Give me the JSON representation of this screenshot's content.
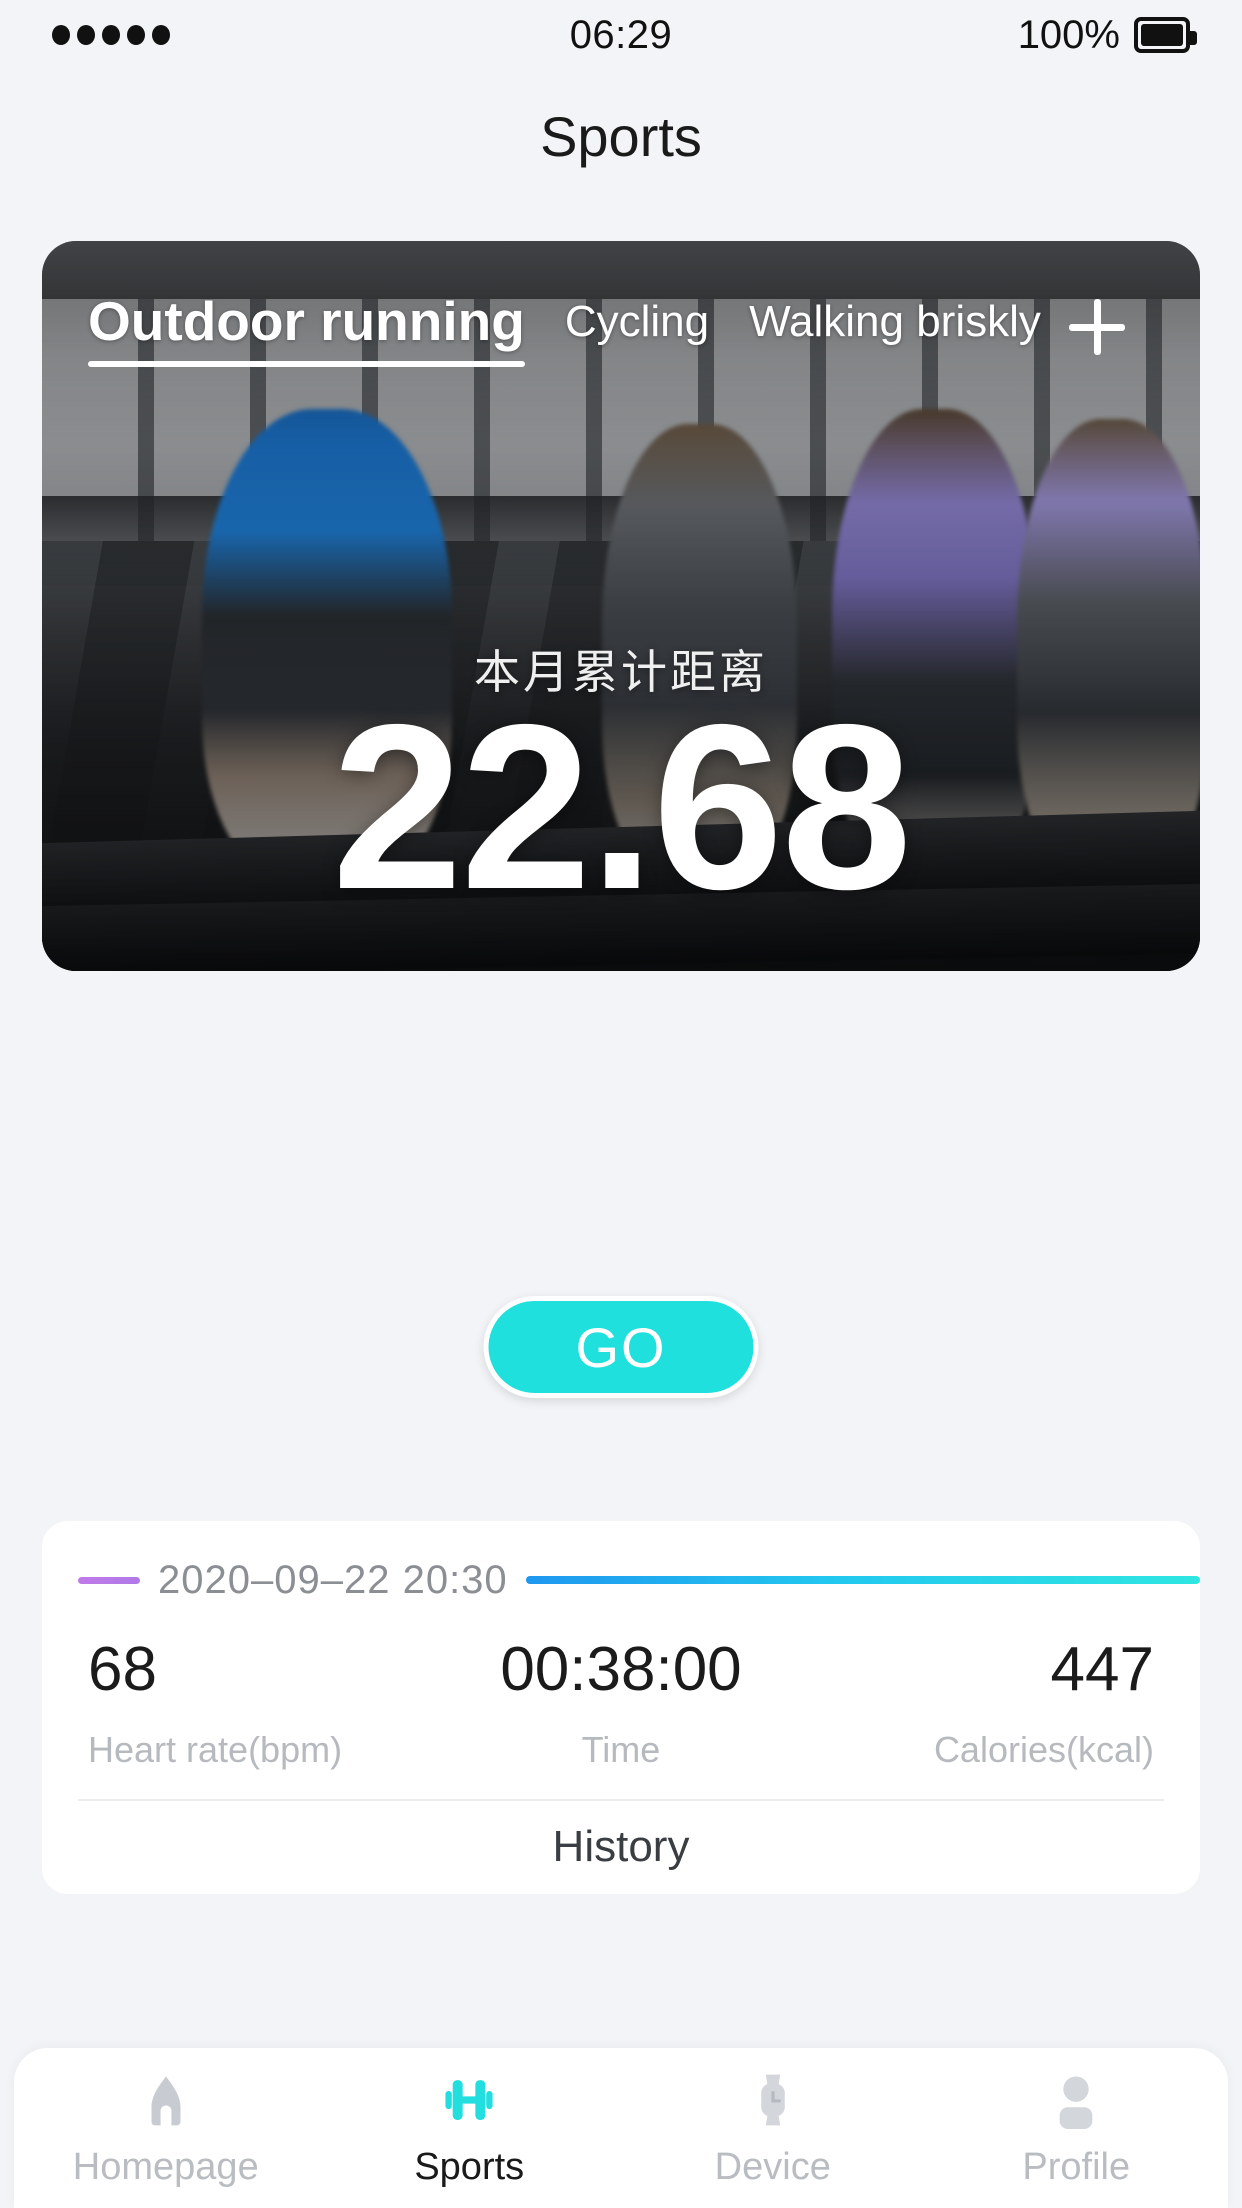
{
  "status_bar": {
    "signal_dots": 5,
    "time": "06:29",
    "battery_percent": "100%",
    "battery_icon": "battery-full-icon"
  },
  "header": {
    "title": "Sports"
  },
  "hero": {
    "tabs": [
      {
        "label": "Outdoor running",
        "active": true
      },
      {
        "label": "Cycling",
        "active": false
      },
      {
        "label": "Walking briskly",
        "active": false
      }
    ],
    "add_tab_icon": "plus-icon",
    "subtitle": "本月累计距离",
    "value": "22.68",
    "actions": [
      {
        "icon": "target-locate-icon",
        "name": "goal-target-button"
      },
      {
        "icon": "gear-icon",
        "name": "settings-button"
      }
    ],
    "go_button": "GO"
  },
  "stats_card": {
    "date": "2020–09–22 20:30",
    "accent_left": "#bf7ae8",
    "accent_line_from": "#1f97ef",
    "accent_line_to": "#2fe6e2",
    "metrics": [
      {
        "value": "68",
        "label": "Heart rate(bpm)"
      },
      {
        "value": "00:38:00",
        "label": "Time"
      },
      {
        "value": "447",
        "label": "Calories(kcal)"
      }
    ],
    "history_label": "History"
  },
  "bottom_nav": {
    "active_color": "#22dede",
    "items": [
      {
        "label": "Homepage",
        "icon": "home-icon",
        "active": false
      },
      {
        "label": "Sports",
        "icon": "dumbbell-icon",
        "active": true
      },
      {
        "label": "Device",
        "icon": "watch-icon",
        "active": false
      },
      {
        "label": "Profile",
        "icon": "person-icon",
        "active": false
      }
    ]
  }
}
